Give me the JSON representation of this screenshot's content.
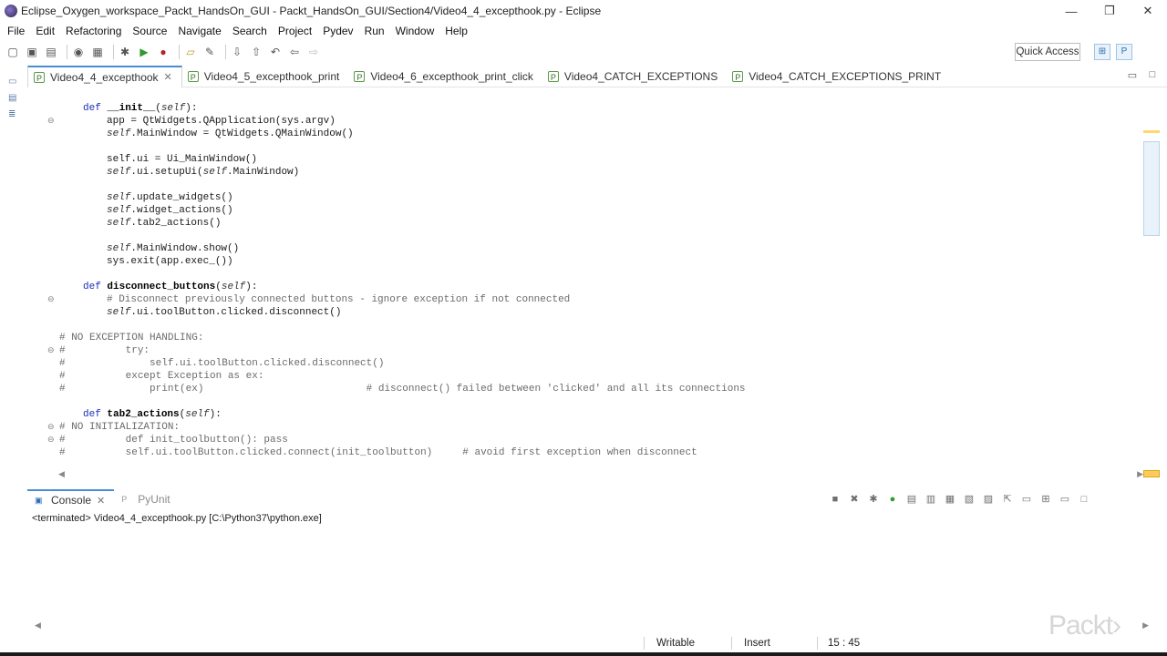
{
  "window": {
    "title": "Eclipse_Oxygen_workspace_Packt_HandsOn_GUI - Packt_HandsOn_GUI/Section4/Video4_4_excepthook.py - Eclipse",
    "minimize": "—",
    "maximize": "❐",
    "close": "✕"
  },
  "menu": [
    "File",
    "Edit",
    "Refactoring",
    "Source",
    "Navigate",
    "Search",
    "Project",
    "Pydev",
    "Run",
    "Window",
    "Help"
  ],
  "toolbar": {
    "quick_access": "Quick Access"
  },
  "editor_tabs": [
    {
      "label": "Video4_4_excepthook",
      "active": true,
      "close": "✕"
    },
    {
      "label": "Video4_5_excepthook_print",
      "active": false
    },
    {
      "label": "Video4_6_excepthook_print_click",
      "active": false
    },
    {
      "label": "Video4_CATCH_EXCEPTIONS",
      "active": false
    },
    {
      "label": "Video4_CATCH_EXCEPTIONS_PRINT",
      "active": false
    }
  ],
  "code": {
    "l01": {
      "fold": "⊖",
      "a": "def ",
      "b": "__init__",
      "c": "(",
      "d": "self",
      "e": "):"
    },
    "l02": "app = QtWidgets.QApplication(sys.argv)",
    "l03": {
      "s": "self",
      "r": ".MainWindow = QtWidgets.QMainWindow()"
    },
    "l04": "self.ui = Ui_MainWindow()",
    "l05": {
      "s": "self",
      "r": ".ui.setupUi(",
      "s2": "self",
      "r2": ".MainWindow)"
    },
    "l06": {
      "s": "self",
      "r": ".update_widgets()"
    },
    "l07": {
      "s": "self",
      "r": ".widget_actions()"
    },
    "l08": {
      "s": "self",
      "r": ".tab2_actions()"
    },
    "l09": {
      "s": "self",
      "r": ".MainWindow.show()"
    },
    "l10": "sys.exit(app.exec_())",
    "l11": {
      "fold": "⊖",
      "a": "def ",
      "b": "disconnect_buttons",
      "c": "(",
      "d": "self",
      "e": "):"
    },
    "l12": "# Disconnect previously connected buttons - ignore exception if not connected",
    "l13": {
      "s": "self",
      "r": ".ui.toolButton.clicked.disconnect()"
    },
    "l14": {
      "fold": "⊖",
      "t": "# NO EXCEPTION HANDLING:"
    },
    "l15": "#          try:",
    "l16": "#              self.ui.toolButton.clicked.disconnect()",
    "l17": "#          except Exception as ex:",
    "l18": "#              print(ex)                           # disconnect() failed between 'clicked' and all its connections",
    "l19": {
      "fold": "⊖",
      "a": "def ",
      "b": "tab2_actions",
      "c": "(",
      "d": "self",
      "e": "):"
    },
    "l20": {
      "fold": "⊖",
      "t": "# NO INITIALIZATION:"
    },
    "l21": "#          def init_toolbutton(): pass",
    "l22": "#          self.ui.toolButton.clicked.connect(init_toolbutton)     # avoid first exception when disconnect"
  },
  "console": {
    "tab_console": "Console",
    "tab_pyunit": "PyUnit",
    "close": "✕",
    "output": "<terminated> Video4_4_excepthook.py [C:\\Python37\\python.exe]"
  },
  "status": {
    "writable": "Writable",
    "insert": "Insert",
    "position": "15 : 45"
  },
  "watermark": "Packt›"
}
